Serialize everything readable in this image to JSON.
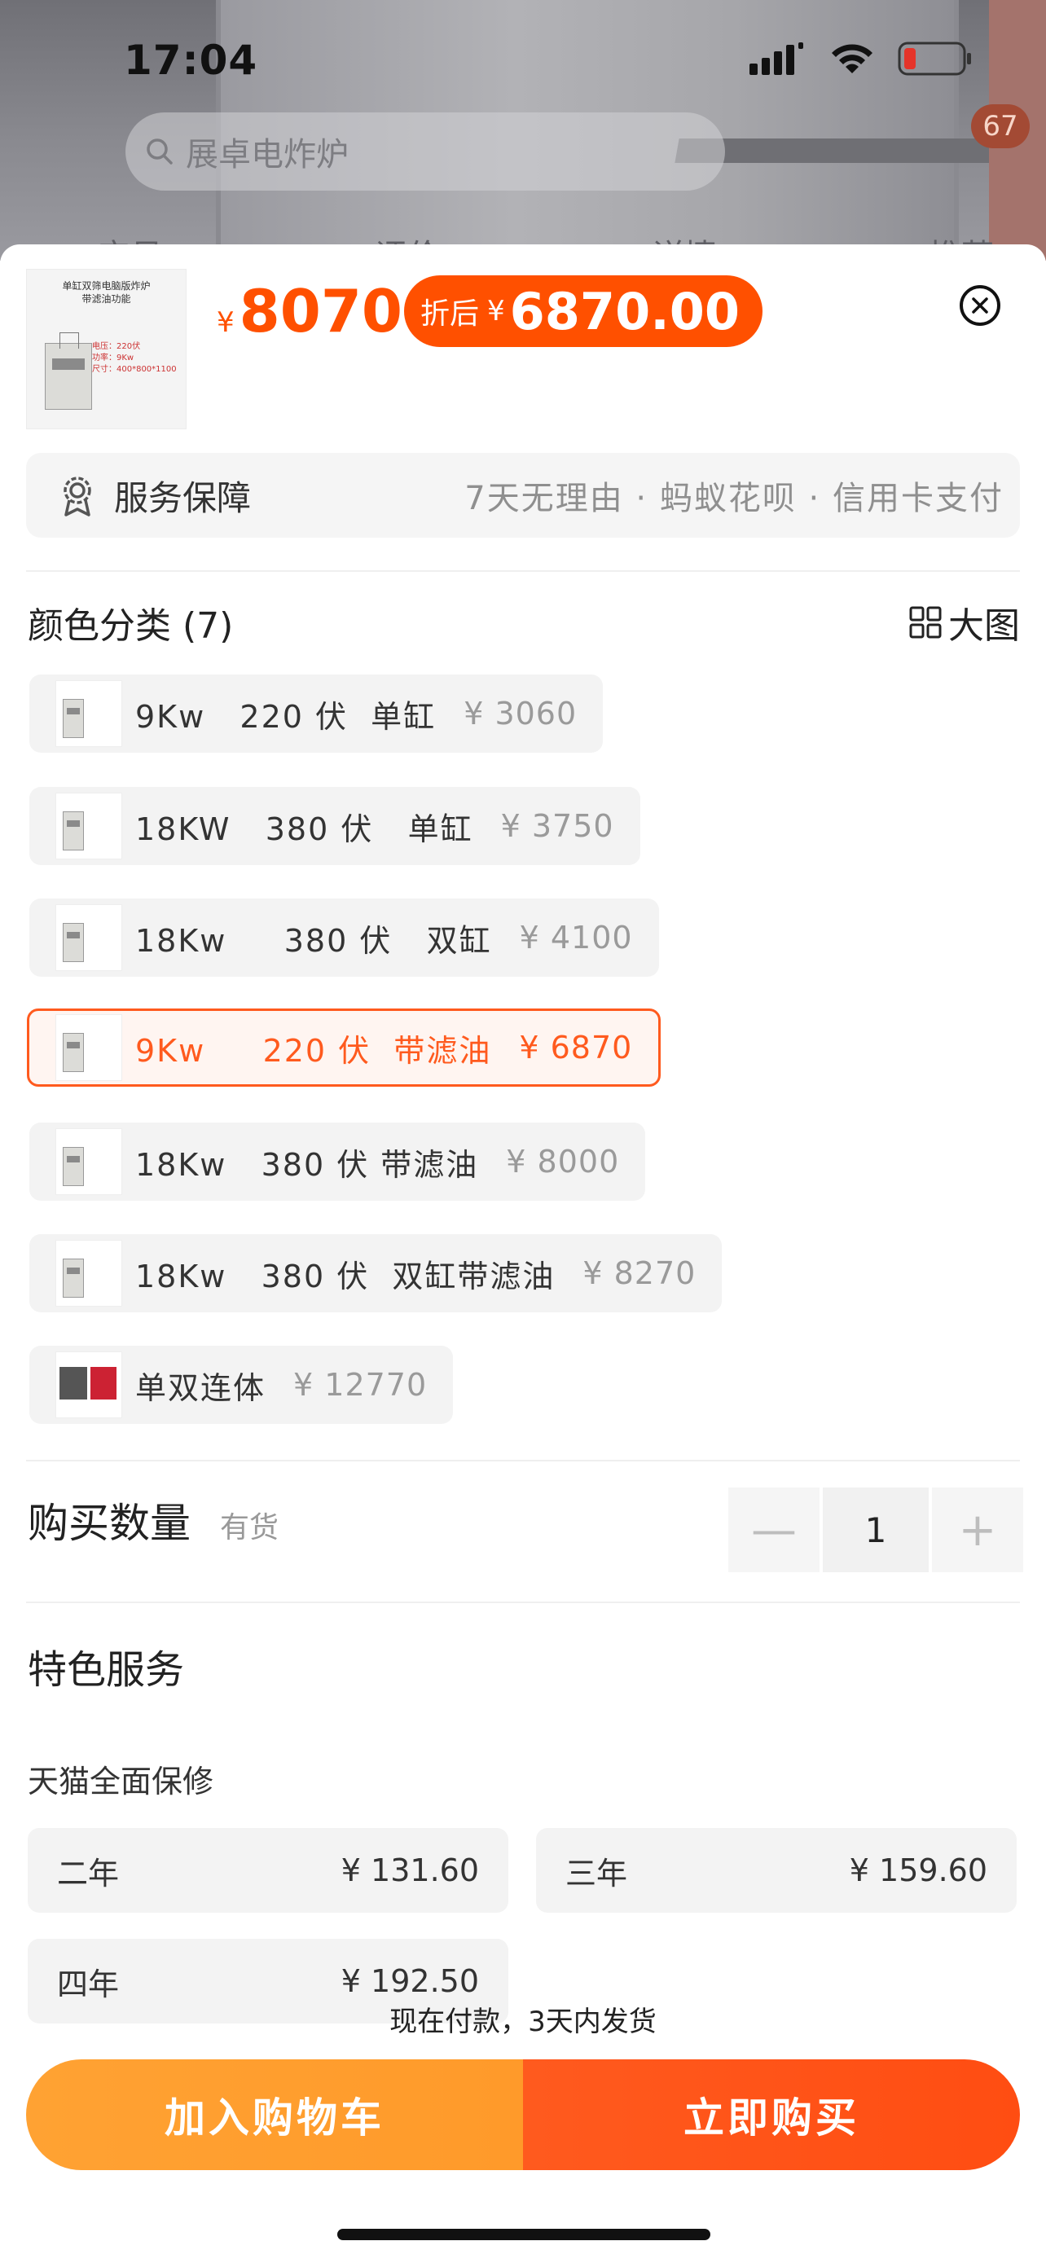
{
  "status_bar": {
    "time": "17:04"
  },
  "background_page": {
    "search_placeholder": "展卓电炸炉",
    "cart_count": "67",
    "tabs": [
      "宝贝",
      "评价",
      "详情",
      "推荐"
    ]
  },
  "sheet": {
    "thumbnail": {
      "caption": "单缸双筛电脑版炸炉\n带滤油功能",
      "specs": "电压：220伏\n功率：9Kw\n尺寸：400*800*1100"
    },
    "price": {
      "currency": "¥",
      "original": "8070",
      "discount_label": "折后",
      "discounted": "6870.00"
    },
    "service": {
      "label": "服务保障",
      "detail": "7天无理由 · 蚂蚁花呗 · 信用卡支付"
    },
    "color_section": {
      "title": "颜色分类 (7)",
      "big_image_label": "大图",
      "options": [
        {
          "name": "9Kw   220 伏  单缸",
          "price": "¥ 3060",
          "selected": false
        },
        {
          "name": "18KW   380 伏   单缸",
          "price": "¥ 3750",
          "selected": false
        },
        {
          "name": "18Kw     380 伏   双缸",
          "price": "¥ 4100",
          "selected": false
        },
        {
          "name": "9Kw     220 伏  带滤油",
          "price": "¥ 6870",
          "selected": true
        },
        {
          "name": "18Kw   380 伏 带滤油",
          "price": "¥ 8000",
          "selected": false
        },
        {
          "name": "18Kw   380 伏  双缸带滤油",
          "price": "¥ 8270",
          "selected": false
        },
        {
          "name": "单双连体",
          "price": "¥ 12770",
          "selected": false
        }
      ]
    },
    "quantity": {
      "label": "购买数量",
      "stock": "有货",
      "value": "1",
      "minus": "—",
      "plus": "+"
    },
    "special_services": {
      "title": "特色服务",
      "warranty_title": "天猫全面保修",
      "options": [
        {
          "name": "二年",
          "price": "¥ 131.60"
        },
        {
          "name": "三年",
          "price": "¥ 159.60"
        },
        {
          "name": "四年",
          "price": "¥ 192.50"
        }
      ]
    },
    "ship_note": "现在付款，3天内发货",
    "buttons": {
      "add_to_cart": "加入购物车",
      "buy_now": "立即购买"
    }
  },
  "colors": {
    "accent": "#FF5000",
    "add_cart": "#FF9A2A",
    "buy_now": "#FF5A1E"
  }
}
